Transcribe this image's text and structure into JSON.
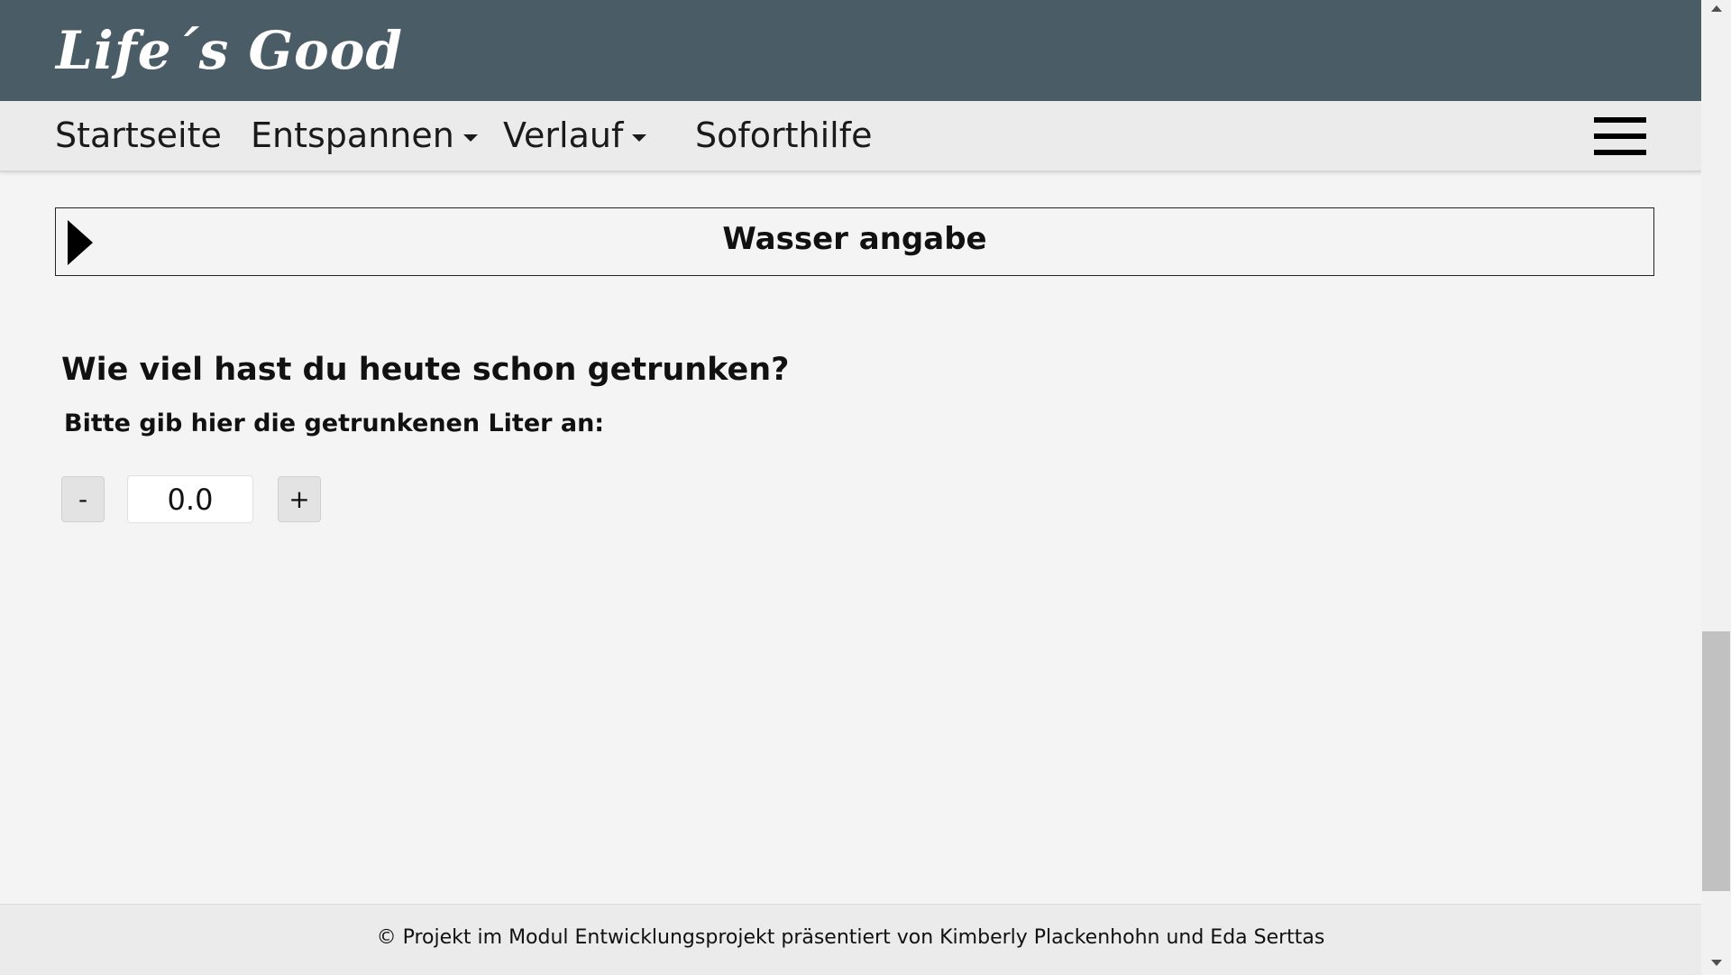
{
  "header": {
    "logo": "Life´s Good"
  },
  "nav": {
    "items": [
      {
        "label": "Startseite",
        "dropdown": false
      },
      {
        "label": "Entspannen",
        "dropdown": true
      },
      {
        "label": "Verlauf",
        "dropdown": true
      },
      {
        "label": "Soforthilfe",
        "dropdown": false
      }
    ],
    "menu_icon": "hamburger-menu-icon"
  },
  "accordion": {
    "title": "Wasser angabe",
    "icon": "triangle-right-icon"
  },
  "form": {
    "question": "Wie viel hast du heute schon getrunken?",
    "prompt": "Bitte gib hier die getrunkenen Liter an:",
    "decrement_label": "-",
    "increment_label": "+",
    "value": "0.0"
  },
  "footer": {
    "text": "© Projekt im Modul Entwicklungsprojekt präsentiert von Kimberly Plackenhohn und Eda Serttas"
  },
  "colors": {
    "header_bg": "#4a5d66",
    "nav_bg": "#ebebeb",
    "page_bg": "#f4f4f4"
  }
}
